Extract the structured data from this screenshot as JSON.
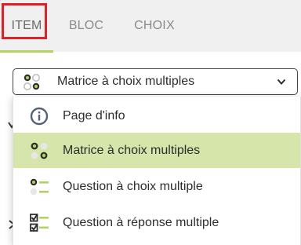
{
  "tabs": [
    {
      "label": "ITEM",
      "active": true
    },
    {
      "label": "BLOC",
      "active": false
    },
    {
      "label": "CHOIX",
      "active": false
    }
  ],
  "select": {
    "value": "Matrice à choix multiples",
    "icon": "matrix-icon"
  },
  "dropdown": {
    "options": [
      {
        "label": "Page d'info",
        "icon": "info-circle-icon",
        "selected": false
      },
      {
        "label": "Matrice à choix multiples",
        "icon": "matrix-icon",
        "selected": true
      },
      {
        "label": "Question à choix multiple",
        "icon": "single-choice-list-icon",
        "selected": false
      },
      {
        "label": "Question à réponse multiple",
        "icon": "multi-checkbox-list-icon",
        "selected": false
      }
    ]
  },
  "colors": {
    "accent_green": "#b2d35f",
    "selected_bg": "#d6e5aa",
    "highlight_red": "#e32026",
    "tabbar_bg": "#f0f0f0"
  }
}
